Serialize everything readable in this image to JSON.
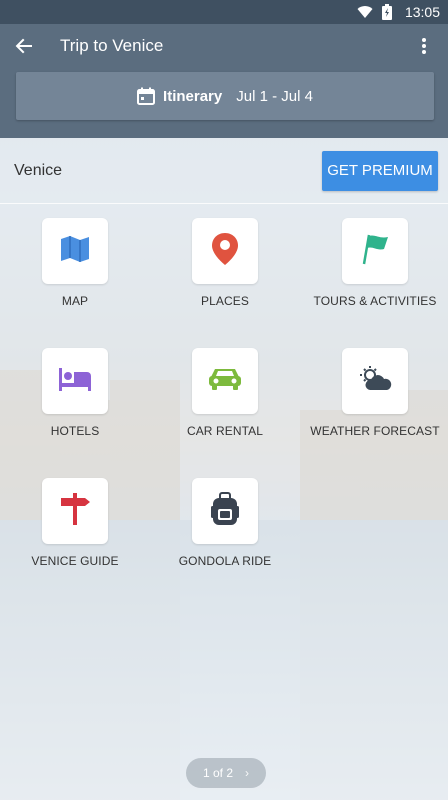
{
  "status_bar": {
    "time": "13:05"
  },
  "app_bar": {
    "title": "Trip to Venice"
  },
  "itinerary": {
    "label": "Itinerary",
    "dates": "Jul 1 - Jul 4"
  },
  "destination": {
    "city": "Venice",
    "premium_button": "GET PREMIUM"
  },
  "tiles": [
    {
      "label": "MAP",
      "icon": "map-icon",
      "color": "#4a8fe0"
    },
    {
      "label": "PLACES",
      "icon": "location-pin-icon",
      "color": "#e0533f"
    },
    {
      "label": "TOURS & ACTIVITIES",
      "icon": "flag-icon",
      "color": "#2fb38c"
    },
    {
      "label": "HOTELS",
      "icon": "bed-icon",
      "color": "#8d63d6"
    },
    {
      "label": "CAR RENTAL",
      "icon": "car-icon",
      "color": "#7dba3d"
    },
    {
      "label": "WEATHER FORECAST",
      "icon": "weather-icon",
      "color": "#3d4a57"
    },
    {
      "label": "VENICE GUIDE",
      "icon": "signpost-icon",
      "color": "#d63440"
    },
    {
      "label": "GONDOLA RIDE",
      "icon": "backpack-icon",
      "color": "#3a4350"
    }
  ],
  "pager": {
    "text": "1 of 2"
  }
}
